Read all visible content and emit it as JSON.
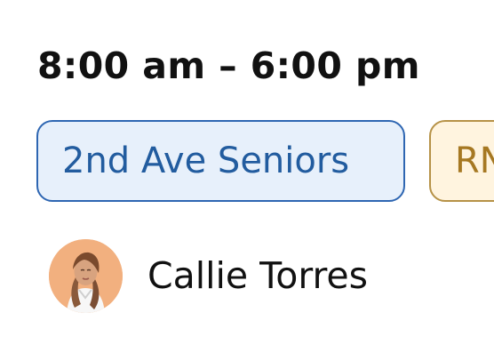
{
  "shift": {
    "time_range": "8:00 am – 6:00 pm"
  },
  "tags": [
    {
      "label": "2nd Ave Seniors",
      "bg": "#e7f0fb",
      "border": "#2e66b2",
      "text_color": "#225c9f"
    },
    {
      "label": "RN",
      "bg": "#fff4df",
      "border": "#b69247",
      "text_color": "#a67822"
    }
  ],
  "assignee": {
    "name": "Callie Torres",
    "avatar_bg": "#f2b07f"
  }
}
